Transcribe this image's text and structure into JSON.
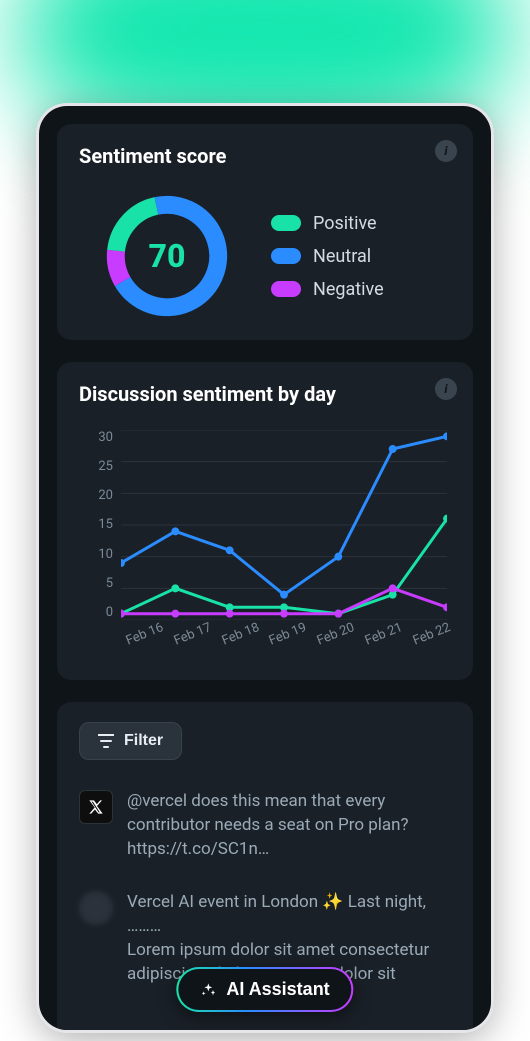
{
  "colors": {
    "positive": "#18e2a8",
    "neutral": "#2a8cff",
    "negative": "#c83cff"
  },
  "sentiment_card": {
    "title": "Sentiment score",
    "value": "70",
    "legend": {
      "positive": "Positive",
      "neutral": "Neutral",
      "negative": "Negative"
    }
  },
  "discussion_card": {
    "title": "Discussion sentiment by day"
  },
  "feed": {
    "filter_label": "Filter",
    "items": [
      {
        "text": "@vercel does this mean that every contributor needs a seat on Pro plan? https://t.co/SC1n…"
      },
      {
        "text": "Vercel AI event in London ✨ Last night, ………"
      }
    ]
  },
  "ai_button": "AI Assistant",
  "chart_data": [
    {
      "type": "donut",
      "title": "Sentiment score",
      "total": 100,
      "series": [
        {
          "name": "Positive",
          "value": 20,
          "color": "#18e2a8"
        },
        {
          "name": "Neutral",
          "value": 70,
          "color": "#2a8cff"
        },
        {
          "name": "Negative",
          "value": 10,
          "color": "#c83cff"
        }
      ],
      "center_label": 70
    },
    {
      "type": "line",
      "title": "Discussion sentiment by day",
      "xlabel": "",
      "ylabel": "",
      "ylim": [
        0,
        30
      ],
      "yticks": [
        0,
        5,
        10,
        15,
        20,
        25,
        30
      ],
      "categories": [
        "Feb 16",
        "Feb 17",
        "Feb 18",
        "Feb 19",
        "Feb 20",
        "Feb 21",
        "Feb 22"
      ],
      "series": [
        {
          "name": "Positive",
          "color": "#18e2a8",
          "values": [
            1,
            5,
            2,
            2,
            1,
            4,
            16
          ]
        },
        {
          "name": "Neutral",
          "color": "#2a8cff",
          "values": [
            9,
            14,
            11,
            4,
            10,
            27,
            29
          ]
        },
        {
          "name": "Negative",
          "color": "#c83cff",
          "values": [
            1,
            1,
            1,
            1,
            1,
            5,
            2
          ]
        }
      ]
    }
  ]
}
